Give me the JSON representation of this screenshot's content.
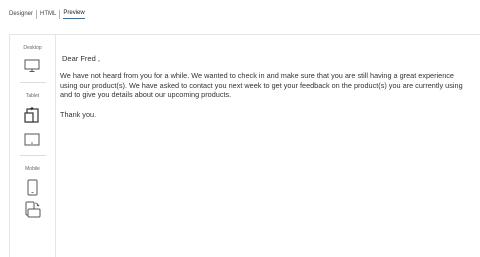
{
  "tabs": [
    {
      "label": "Designer"
    },
    {
      "label": "HTML"
    },
    {
      "label": "Preview",
      "active": true
    }
  ],
  "devices": {
    "desktop_label": "Desktop",
    "tablet_label": "Tablet",
    "mobile_label": "Mobile"
  },
  "email": {
    "greeting": "Dear Fred ,",
    "body": "We have not heard from you for a while. We wanted to check in and make sure that you are still having a great experience using our product(s). We have asked to contact you next week to get your feedback on the product(s) you are currently using and to give you details about our upcoming products.",
    "signoff": "Thank you."
  },
  "colors": {
    "accent": "#1a73c7",
    "border": "#e4e4e4"
  },
  "icons": [
    "desktop-monitor-icon",
    "tablet-rotate-icon",
    "tablet-landscape-icon",
    "mobile-portrait-icon",
    "mobile-rotate-icon"
  ]
}
